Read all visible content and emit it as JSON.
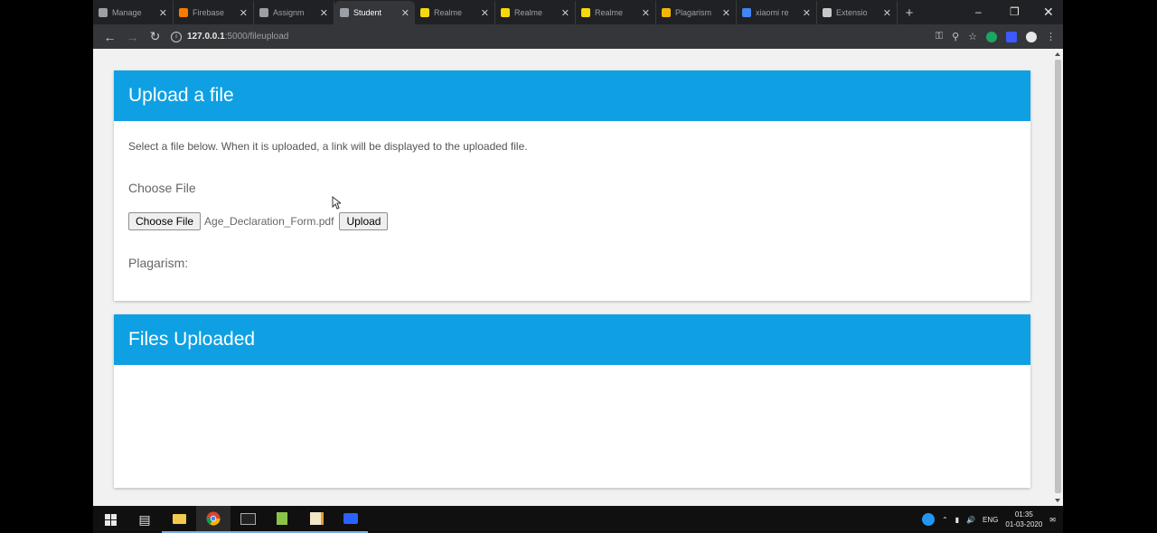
{
  "browser": {
    "tabs": [
      {
        "label": "Manage",
        "icon": "settings-icon",
        "color": "#9aa0a6"
      },
      {
        "label": "Firebase",
        "icon": "firebase-icon",
        "color": "#f57c00"
      },
      {
        "label": "Assignm",
        "icon": "globe-icon",
        "color": "#9aa0a6"
      },
      {
        "label": "Student",
        "icon": "globe-icon",
        "color": "#9aa0a6",
        "active": true
      },
      {
        "label": "Realme",
        "icon": "realme-icon",
        "color": "#f5d90a"
      },
      {
        "label": "Realme",
        "icon": "realme-icon",
        "color": "#f5d90a"
      },
      {
        "label": "Realme",
        "icon": "realme-icon",
        "color": "#f5d90a"
      },
      {
        "label": "Plagarism",
        "icon": "bookmark-icon",
        "color": "#f2b705"
      },
      {
        "label": "xiaomi re",
        "icon": "google-icon",
        "color": "#4285f4"
      },
      {
        "label": "Extensio",
        "icon": "puzzle-icon",
        "color": "#c8c8c8"
      }
    ],
    "url_host": "127.0.0.1",
    "url_rest": ":5000/fileupload"
  },
  "upload_card": {
    "title": "Upload a file",
    "description": "Select a file below. When it is uploaded, a link will be displayed to the uploaded file.",
    "choose_label": "Choose File",
    "choose_button": "Choose File",
    "file_name": "Age_Declaration_Form.pdf",
    "upload_button": "Upload",
    "plagiarism_label": "Plagarism:"
  },
  "files_card": {
    "title": "Files Uploaded"
  },
  "taskbar": {
    "language": "ENG",
    "time": "01:35",
    "date": "01-03-2020"
  },
  "colors": {
    "header_blue": "#0fa0e3",
    "chrome_dark": "#202124"
  }
}
